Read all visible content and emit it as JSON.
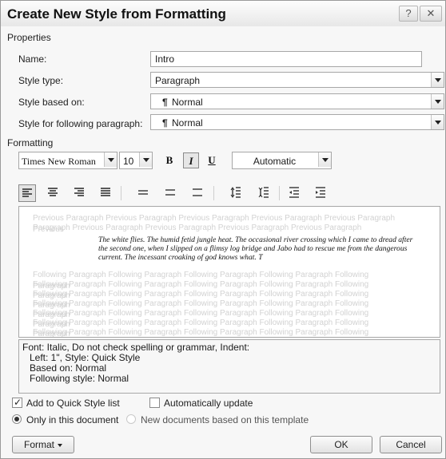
{
  "title": "Create New Style from Formatting",
  "title_buttons": {
    "help_icon": "question-mark-icon",
    "close_icon": "close-icon",
    "help_glyph": "?",
    "close_glyph": "✕"
  },
  "properties": {
    "header": "Properties",
    "name": {
      "label": "Name:",
      "value": "Intro"
    },
    "style_type": {
      "label": "Style type:",
      "value": "Paragraph"
    },
    "based_on": {
      "label": "Style based on:",
      "glyph": "¶",
      "value": "Normal"
    },
    "following": {
      "label": "Style for following paragraph:",
      "glyph": "¶",
      "value": "Normal"
    }
  },
  "formatting": {
    "header": "Formatting",
    "font": "Times New Roman",
    "size": "10",
    "bold_label": "B",
    "italic_label": "I",
    "underline_label": "U",
    "color": "Automatic",
    "italic_pressed": true
  },
  "preview": {
    "prev_line_1": "Previous Paragraph Previous Paragraph Previous Paragraph Previous Paragraph Previous Paragraph Previous",
    "prev_line_2": "Paragraph Previous Paragraph Previous Paragraph Previous Paragraph Previous Paragraph",
    "sample_text": "The white flies. The humid fetid jungle heat. The occasional river crossing which I came to dread after the second one, when I slipped on a flimsy log bridge and Jabo had to rescue me from the dangerous current. The incessant croaking of god knows what. T",
    "following_lines": [
      "Following Paragraph Following Paragraph Following Paragraph Following Paragraph Following Paragraph",
      "Following Paragraph Following Paragraph Following Paragraph Following Paragraph Following Paragraph",
      "Following Paragraph Following Paragraph Following Paragraph Following Paragraph Following Paragraph",
      "Following Paragraph Following Paragraph Following Paragraph Following Paragraph Following Paragraph",
      "Following Paragraph Following Paragraph Following Paragraph Following Paragraph Following Paragraph",
      "Following Paragraph Following Paragraph Following Paragraph Following Paragraph Following Paragraph",
      "Following Paragraph Following Paragraph Following Paragraph Following Paragraph Following Paragraph"
    ]
  },
  "description": {
    "line1": "Font: Italic, Do not check spelling or grammar, Indent:",
    "line2": "Left:  1\", Style: Quick Style",
    "line3": "Based on: Normal",
    "line4": "Following style: Normal"
  },
  "options": {
    "add_quick_style": {
      "label": "Add to Quick Style list",
      "checked": true
    },
    "auto_update": {
      "label": "Automatically update",
      "checked": false
    },
    "only_this_doc": {
      "label": "Only in this document",
      "selected": true
    },
    "new_docs": {
      "label": "New documents based on this template",
      "selected": false
    }
  },
  "buttons": {
    "format": "Format",
    "ok": "OK",
    "cancel": "Cancel"
  }
}
